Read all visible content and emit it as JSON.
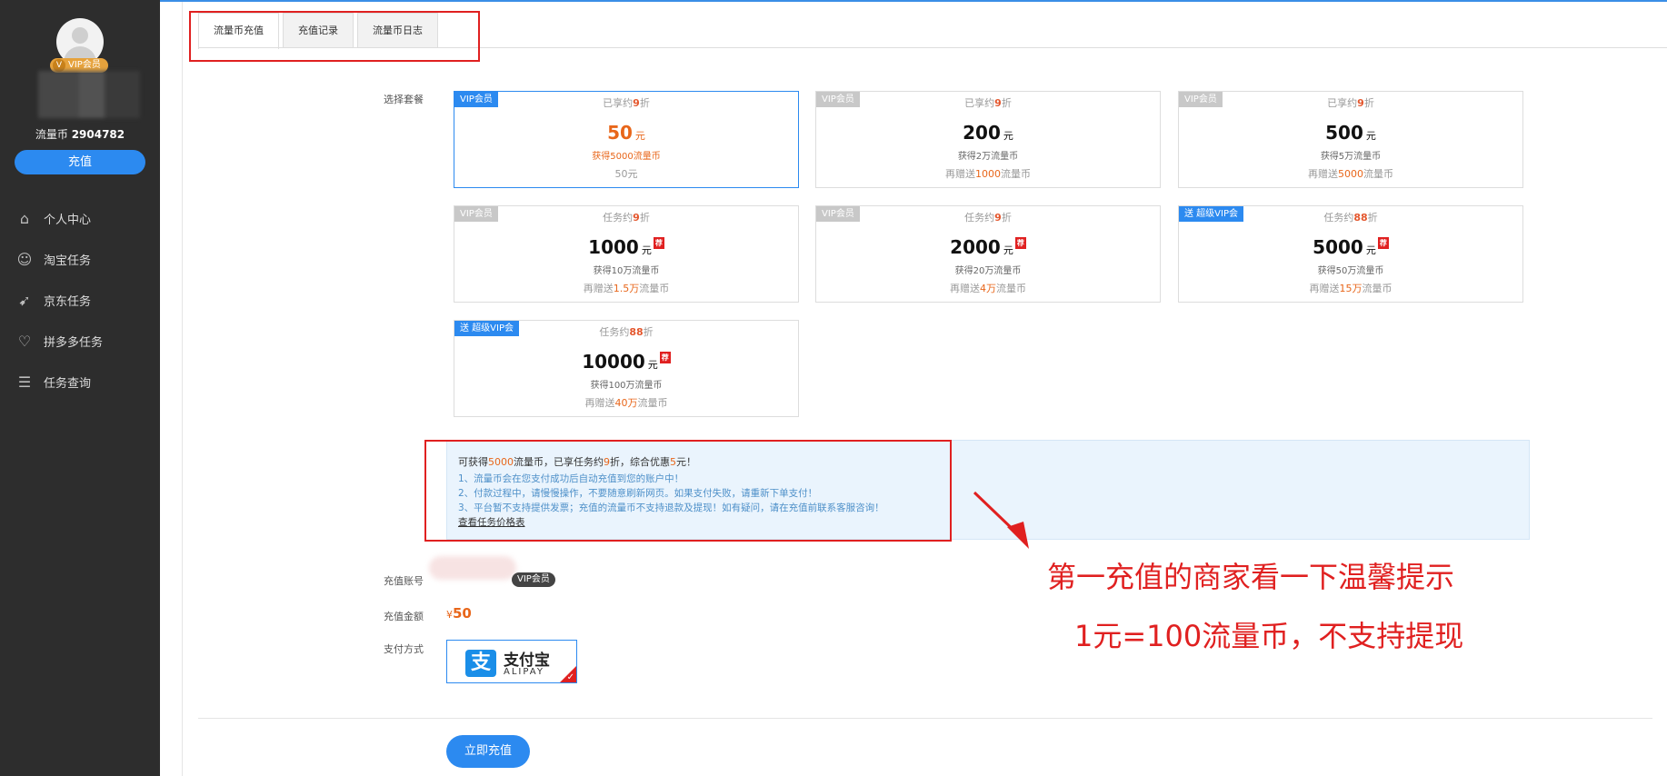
{
  "sidebar": {
    "vip_badge": "VIP会员",
    "vip_badge_icon": "V",
    "coins_label": "流量币",
    "coins_value": "2904782",
    "recharge_button": "充值",
    "nav": [
      {
        "label": "个人中心",
        "icon": "home-icon"
      },
      {
        "label": "淘宝任务",
        "icon": "taobao-icon"
      },
      {
        "label": "京东任务",
        "icon": "jd-icon"
      },
      {
        "label": "拼多多任务",
        "icon": "pinduoduo-icon"
      },
      {
        "label": "任务查询",
        "icon": "search-list-icon"
      }
    ]
  },
  "tabs": [
    {
      "label": "流量币充值",
      "active": true
    },
    {
      "label": "充值记录",
      "active": false
    },
    {
      "label": "流量币日志",
      "active": false
    }
  ],
  "form": {
    "package_label": "选择套餐",
    "account_label": "充值账号",
    "account_badge": "VIP会员",
    "amount_label": "充值金额",
    "amount_currency": "¥",
    "amount_value": "50",
    "payment_label": "支付方式",
    "alipay_cn": "支付宝",
    "alipay_en": "ALIPAY",
    "alipay_logo": "支",
    "submit_button": "立即充值"
  },
  "packages": [
    {
      "tag": "VIP会员",
      "disc_prefix": "已享约",
      "disc_value": "9",
      "disc_suffix": "折",
      "price": "50",
      "unit": "元",
      "get": "获得5000流量币",
      "gift_prefix": "",
      "gift_value": "",
      "gift_suffix": "50元",
      "hot": false,
      "selected": true
    },
    {
      "tag": "VIP会员",
      "disc_prefix": "已享约",
      "disc_value": "9",
      "disc_suffix": "折",
      "price": "200",
      "unit": "元",
      "get": "获得2万流量币",
      "gift_prefix": "再赠送",
      "gift_value": "1000",
      "gift_suffix": "流量币",
      "hot": false,
      "selected": false
    },
    {
      "tag": "VIP会员",
      "disc_prefix": "已享约",
      "disc_value": "9",
      "disc_suffix": "折",
      "price": "500",
      "unit": "元",
      "get": "获得5万流量币",
      "gift_prefix": "再赠送",
      "gift_value": "5000",
      "gift_suffix": "流量币",
      "hot": false,
      "selected": false
    },
    {
      "tag": "VIP会员",
      "disc_prefix": "任务约",
      "disc_value": "9",
      "disc_suffix": "折",
      "price": "1000",
      "unit": "元",
      "get": "获得10万流量币",
      "gift_prefix": "再赠送",
      "gift_value": "1.5万",
      "gift_suffix": "流量币",
      "hot": true,
      "selected": false
    },
    {
      "tag": "VIP会员",
      "disc_prefix": "任务约",
      "disc_value": "9",
      "disc_suffix": "折",
      "price": "2000",
      "unit": "元",
      "get": "获得20万流量币",
      "gift_prefix": "再赠送",
      "gift_value": "4万",
      "gift_suffix": "流量币",
      "hot": true,
      "selected": false
    },
    {
      "tag": "送 超级VIP会",
      "disc_prefix": "任务约",
      "disc_value": "88",
      "disc_suffix": "折",
      "price": "5000",
      "unit": "元",
      "get": "获得50万流量币",
      "gift_prefix": "再赠送",
      "gift_value": "15万",
      "gift_suffix": "流量币",
      "hot": true,
      "selected": false,
      "blue_tag": true
    },
    {
      "tag": "送 超级VIP会",
      "disc_prefix": "任务约",
      "disc_value": "88",
      "disc_suffix": "折",
      "price": "10000",
      "unit": "元",
      "get": "获得100万流量币",
      "gift_prefix": "再赠送",
      "gift_value": "40万",
      "gift_suffix": "流量币",
      "hot": true,
      "selected": false,
      "blue_tag": true
    }
  ],
  "hot_glyph": "荐",
  "notice": {
    "line1_a": "可获得",
    "line1_b": "5000",
    "line1_c": "流量币，已享任务约",
    "line1_d": "9",
    "line1_e": "折，综合优惠",
    "line1_f": "5",
    "line1_g": "元！",
    "items": [
      "1、流量币会在您支付成功后自动充值到您的账户中！",
      "2、付款过程中，请慢慢操作，不要随意刷新网页。如果支付失败，请重新下单支付！",
      "3、平台暂不支持提供发票；充值的流量币不支持退款及提现！如有疑问，请在充值前联系客服咨询！"
    ],
    "link": "查看任务价格表"
  },
  "annotation": {
    "line1": "第一充值的商家看一下温馨提示",
    "line2": "1元=100流量币，不支持提现"
  },
  "colors": {
    "accent": "#2c8af0",
    "sidebar_bg": "#2d2d2d",
    "highlight": "#e8661a",
    "annotation_red": "#e02020"
  }
}
